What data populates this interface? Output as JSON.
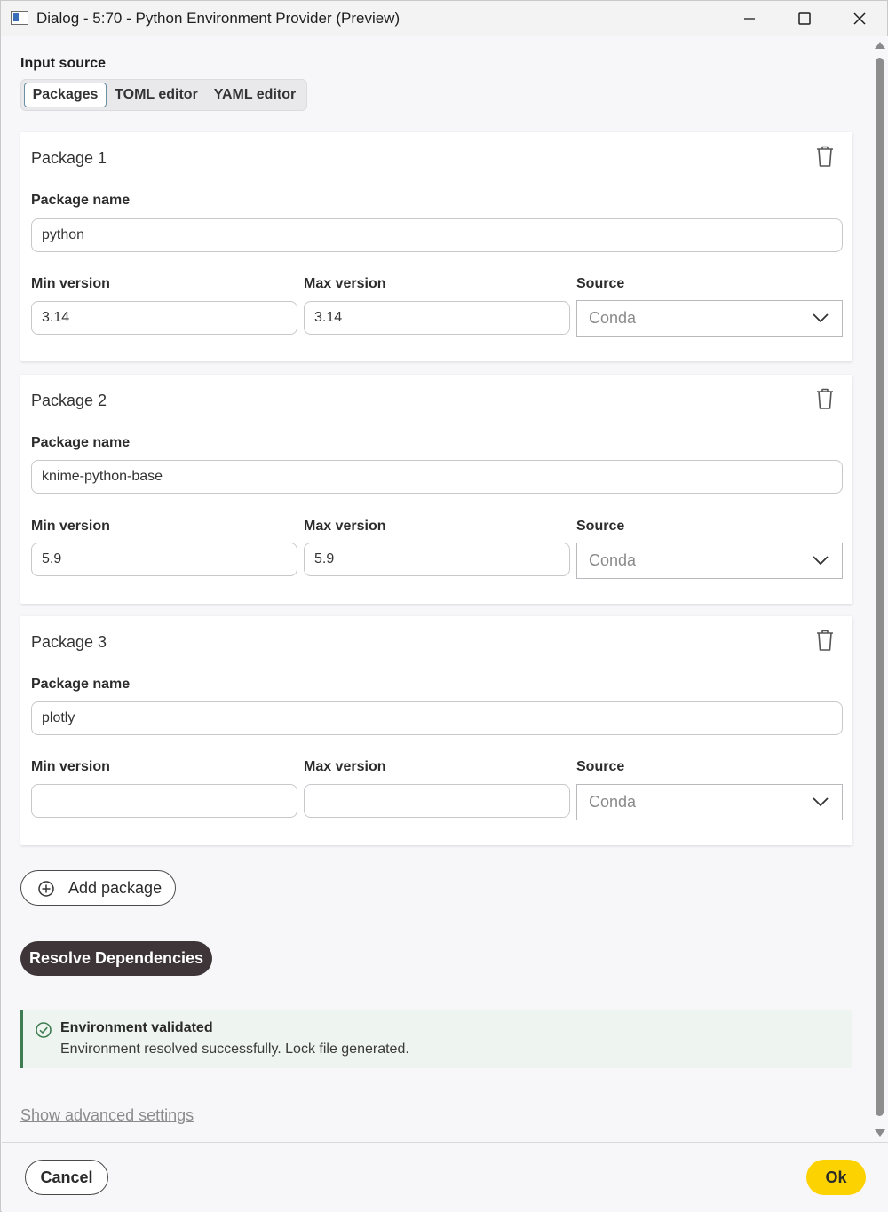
{
  "window": {
    "title": "Dialog - 5:70 - Python Environment Provider (Preview)"
  },
  "input_source": {
    "label": "Input source",
    "tabs": [
      {
        "label": "Packages",
        "selected": true
      },
      {
        "label": "TOML editor",
        "selected": false
      },
      {
        "label": "YAML editor",
        "selected": false
      }
    ]
  },
  "field_labels": {
    "package_name": "Package name",
    "min_version": "Min version",
    "max_version": "Max version",
    "source": "Source"
  },
  "packages": [
    {
      "title": "Package 1",
      "name": "python",
      "min_version": "3.14",
      "max_version": "3.14",
      "source": "Conda"
    },
    {
      "title": "Package 2",
      "name": "knime-python-base",
      "min_version": "5.9",
      "max_version": "5.9",
      "source": "Conda"
    },
    {
      "title": "Package 3",
      "name": "plotly",
      "min_version": "",
      "max_version": "",
      "source": "Conda"
    }
  ],
  "actions": {
    "add_package": "Add package",
    "resolve": "Resolve Dependencies",
    "advanced": "Show advanced settings",
    "cancel": "Cancel",
    "ok": "Ok"
  },
  "notice": {
    "title": "Environment validated",
    "message": "Environment resolved successfully. Lock file generated."
  },
  "colors": {
    "ok_button": "#fcd200",
    "resolve_button": "#3d3537",
    "success": "#3e7d52"
  },
  "icons": [
    "app-icon",
    "minimize-icon",
    "maximize-icon",
    "close-icon",
    "trash-icon",
    "chevron-down-icon",
    "plus-circle-icon",
    "check-circle-icon"
  ]
}
